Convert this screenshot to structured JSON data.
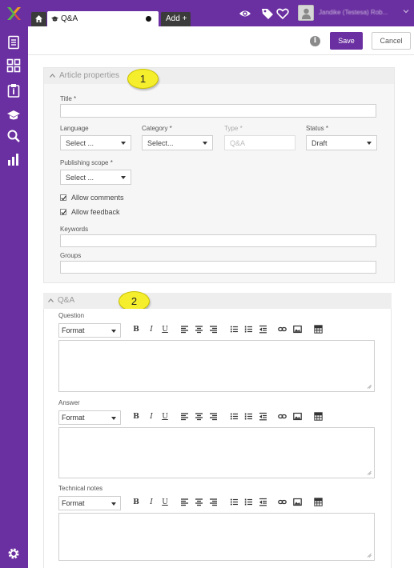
{
  "tabs": {
    "home_icon": "home-icon",
    "active_tab_label": "Q&A",
    "add_tab_label": "Add +"
  },
  "header": {
    "user_name": "Jandike (Testesa) Rob...",
    "icons": [
      "eye-icon",
      "tag-icon",
      "heart-icon",
      "user-icon",
      "chevron-down-icon"
    ]
  },
  "rail": {
    "icons": [
      "logo-icon",
      "document-icon",
      "grid-icon",
      "clipboard-icon",
      "graduation-cap-icon",
      "search-icon",
      "bar-chart-icon",
      "settings-icon"
    ]
  },
  "actions": {
    "info_label": "i",
    "save_label": "Save",
    "cancel_label": "Cancel"
  },
  "article_properties": {
    "section_title": "Article properties",
    "callout": "1",
    "title_label": "Title *",
    "title_value": "",
    "language_label": "Language",
    "language_value": "Select ...",
    "category_label": "Category *",
    "category_value": "Select...",
    "type_label": "Type *",
    "type_value": "Q&A",
    "status_label": "Status *",
    "status_value": "Draft",
    "publishing_scope_label": "Publishing scope *",
    "publishing_scope_value": "Select ...",
    "allow_comments_label": "Allow comments",
    "allow_comments_checked": true,
    "allow_feedback_label": "Allow feedback",
    "allow_feedback_checked": true,
    "keywords_label": "Keywords",
    "keywords_value": "",
    "groups_label": "Groups",
    "groups_value": ""
  },
  "qa": {
    "section_title": "Q&A",
    "callout": "2",
    "editors": [
      {
        "label": "Question",
        "format_value": "Format"
      },
      {
        "label": "Answer",
        "format_value": "Format"
      },
      {
        "label": "Technical notes",
        "format_value": "Format"
      }
    ],
    "toolbar_buttons": {
      "bold": "B",
      "italic": "I",
      "underline": "U"
    }
  },
  "colors": {
    "brand_purple": "#6a2fa0",
    "callout_yellow": "#f5ee2c",
    "dark_tab": "#3b3b3b"
  }
}
